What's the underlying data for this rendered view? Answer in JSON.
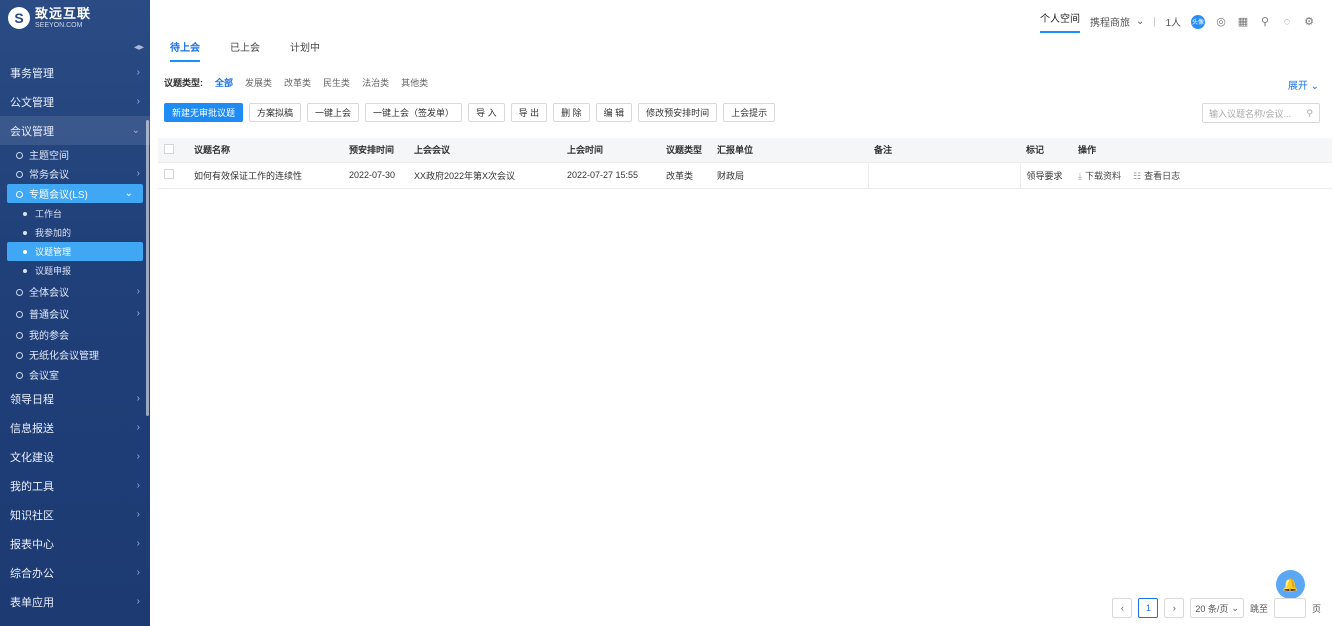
{
  "brand": {
    "name": "致远互联",
    "sub": "SEEYON.COM"
  },
  "sidebar": {
    "items_top": [
      {
        "label": "事务管理"
      },
      {
        "label": "公文管理"
      },
      {
        "label": "会议管理"
      }
    ],
    "meeting_sub": [
      {
        "label": "主题空间"
      },
      {
        "label": "常务会议"
      },
      {
        "label": "专题会议(LS)"
      }
    ],
    "ls_leaves": [
      {
        "label": "工作台"
      },
      {
        "label": "我参加的"
      },
      {
        "label": "议题管理"
      },
      {
        "label": "议题申报"
      }
    ],
    "meeting_sub2": [
      {
        "label": "全体会议"
      },
      {
        "label": "普通会议"
      },
      {
        "label": "我的参会"
      },
      {
        "label": "无纸化会议管理"
      },
      {
        "label": "会议室"
      }
    ],
    "items_bottom": [
      {
        "label": "领导日程"
      },
      {
        "label": "信息报送"
      },
      {
        "label": "文化建设"
      },
      {
        "label": "我的工具"
      },
      {
        "label": "知识社区"
      },
      {
        "label": "报表中心"
      },
      {
        "label": "综合办公"
      },
      {
        "label": "表单应用"
      }
    ]
  },
  "topbar": {
    "personal": "个人空间",
    "tenant": "携程商旅",
    "count": "1人",
    "avatar": "头像"
  },
  "tabs": [
    "待上会",
    "已上会",
    "计划中"
  ],
  "filter": {
    "label": "议题类型:",
    "options": [
      "全部",
      "发展类",
      "改革类",
      "民生类",
      "法治类",
      "其他类"
    ],
    "expand": "展开"
  },
  "toolbar": [
    "新建无审批议题",
    "方案拟稿",
    "一键上会",
    "一键上会（签发单）",
    "导 入",
    "导 出",
    "删 除",
    "编 辑",
    "修改预安排时间",
    "上会提示"
  ],
  "search_placeholder": "输入议题名称/会议...",
  "table": {
    "headers": [
      "议题名称",
      "预安排时间",
      "上会会议",
      "上会时间",
      "议题类型",
      "汇报单位",
      "备注",
      "标记",
      "操作"
    ],
    "rows": [
      {
        "name": "如何有效保证工作的连续性",
        "plan_time": "2022-07-30",
        "meeting": "XX政府2022年第X次会议",
        "meeting_time": "2022-07-27 15:55",
        "type": "改革类",
        "unit": "财政局",
        "note": "",
        "mark": "领导要求",
        "op_download": "下载资料",
        "op_log": "查看日志"
      }
    ]
  },
  "pager": {
    "current": "1",
    "size": "20 条/页",
    "jump": "跳至",
    "page_unit": "页"
  }
}
